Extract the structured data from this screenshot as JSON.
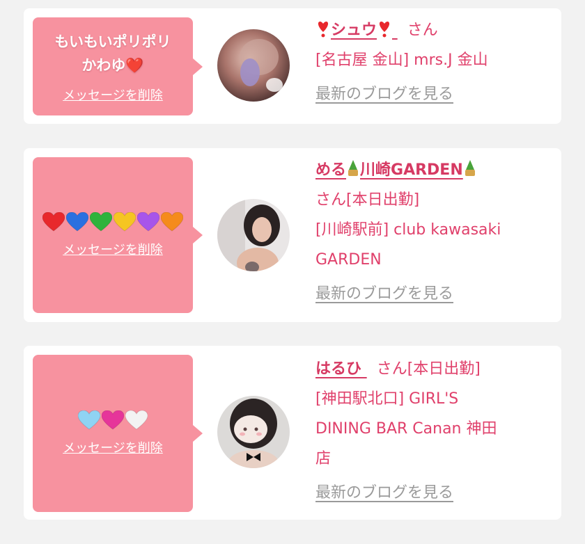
{
  "cards": [
    {
      "message": [
        "もいもいポリポリ",
        "かわゆ❤️"
      ],
      "delete_label": "メッセージを削除",
      "name": "シュウ",
      "honorific": "さん",
      "shop": "[名古屋 金山] mrs.J 金山",
      "blog_label": "最新のブログを見る"
    },
    {
      "hearts": [
        "#e8282c",
        "#2a70e0",
        "#2fb33c",
        "#f5c522",
        "#a755ea",
        "#f58b1c"
      ],
      "delete_label": "メッセージを削除",
      "name": "める",
      "name_suffix": "川崎GARDEN",
      "honorific": "さん[本日出勤]",
      "shop_lines": [
        "[川崎駅前] club kawasaki",
        "GARDEN"
      ],
      "blog_label": "最新のブログを見る"
    },
    {
      "hearts": [
        "#8fd3f3",
        "#e6359a",
        "#f3f3f3"
      ],
      "delete_label": "メッセージを削除",
      "name": "はるひ",
      "honorific": "さん[本日出勤]",
      "shop_lines": [
        "[神田駅北口] GIRL'S",
        "DINING BAR Canan 神田",
        "店"
      ],
      "blog_label": "最新のブログを見る"
    }
  ]
}
